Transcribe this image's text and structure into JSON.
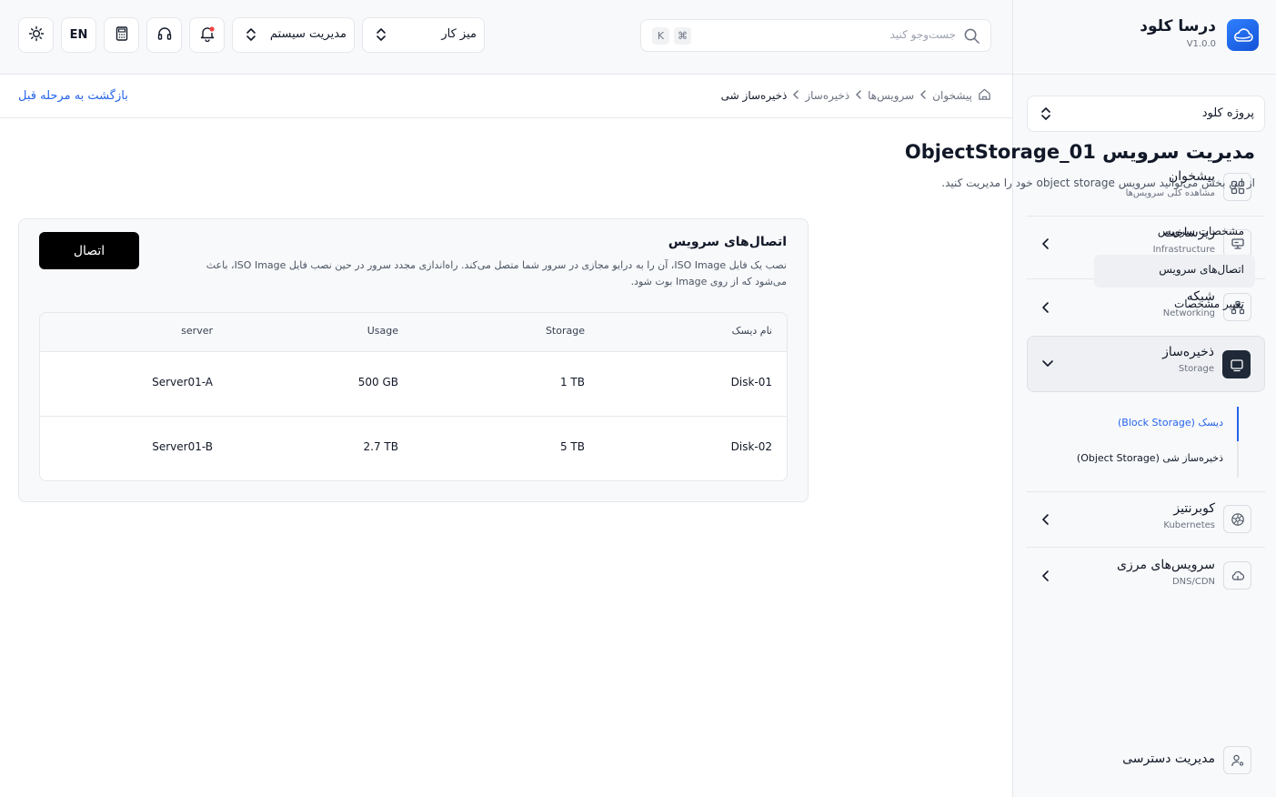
{
  "brand": {
    "name": "درسا کلود",
    "version": "V1.0.0"
  },
  "project": {
    "label": "پروژه کلود"
  },
  "nav": [
    {
      "title": "پیشخوان",
      "subtitle": "مشاهده کلی سرویس‌ها",
      "icon": "grid-icon"
    },
    {
      "title": "زیرساخت",
      "subtitle": "Infrastructure",
      "icon": "server-icon"
    },
    {
      "title": "شبکه",
      "subtitle": "Networking",
      "icon": "network-icon"
    },
    {
      "title": "ذخیره‌ساز",
      "subtitle": "Storage",
      "icon": "storage-icon"
    },
    {
      "title": "کوبرنتیز",
      "subtitle": "Kubernetes",
      "icon": "kubernetes-icon"
    },
    {
      "title": "سرویس‌های مرزی",
      "subtitle": "DNS/CDN",
      "icon": "cloud-icon"
    }
  ],
  "storage_sub": [
    {
      "label": "دیسک (Block Storage)"
    },
    {
      "label": "ذخیره‌ساز شی (Object Storage)"
    }
  ],
  "access": {
    "label": "مدیریت دسترسی"
  },
  "header": {
    "search_placeholder": "جست‌وجو کنید",
    "kbd_cmd": "⌘",
    "kbd_k": "K",
    "workspace": "میز کار",
    "system": "مدیریت سیستم",
    "lang": "EN"
  },
  "breadcrumb": [
    "پیشخوان",
    "سرویس‌ها",
    "ذخیره‌ساز",
    "ذخیره‌ساز شی"
  ],
  "back": "بازگشت به مرحله قبل",
  "page": {
    "title": "مدیریت سرویس ObjectStorage_01",
    "desc": "از این بخش می‌توانید سرویس object storage خود را مدیریت کنید."
  },
  "tabs": [
    "مشخصات سرویس",
    "اتصال‌های سرویس",
    "تغییر مشخصات"
  ],
  "card": {
    "title": "اتصال‌های سرویس",
    "desc": "نصب یک فایل ISO Image، آن را به درایو مجازی در سرور شما متصل می‌کند. راه‌اندازی مجدد سرور در حین نصب فایل ISO Image، باعث می‌شود که از روی Image بوت شود.",
    "button": "اتصال"
  },
  "table": {
    "headers": {
      "disk": "نام دیسک",
      "storage": "Storage",
      "usage": "Usage",
      "server": "server"
    },
    "rows": [
      {
        "disk": "Disk-01",
        "storage": "1 TB",
        "usage": "500 GB",
        "server": "Server01-A"
      },
      {
        "disk": "Disk-02",
        "storage": "5 TB",
        "usage": "2.7 TB",
        "server": "Server01-B"
      }
    ]
  },
  "colors": {
    "accent": "#2563eb",
    "primary_button": "#000000",
    "border": "#e5e7eb"
  }
}
